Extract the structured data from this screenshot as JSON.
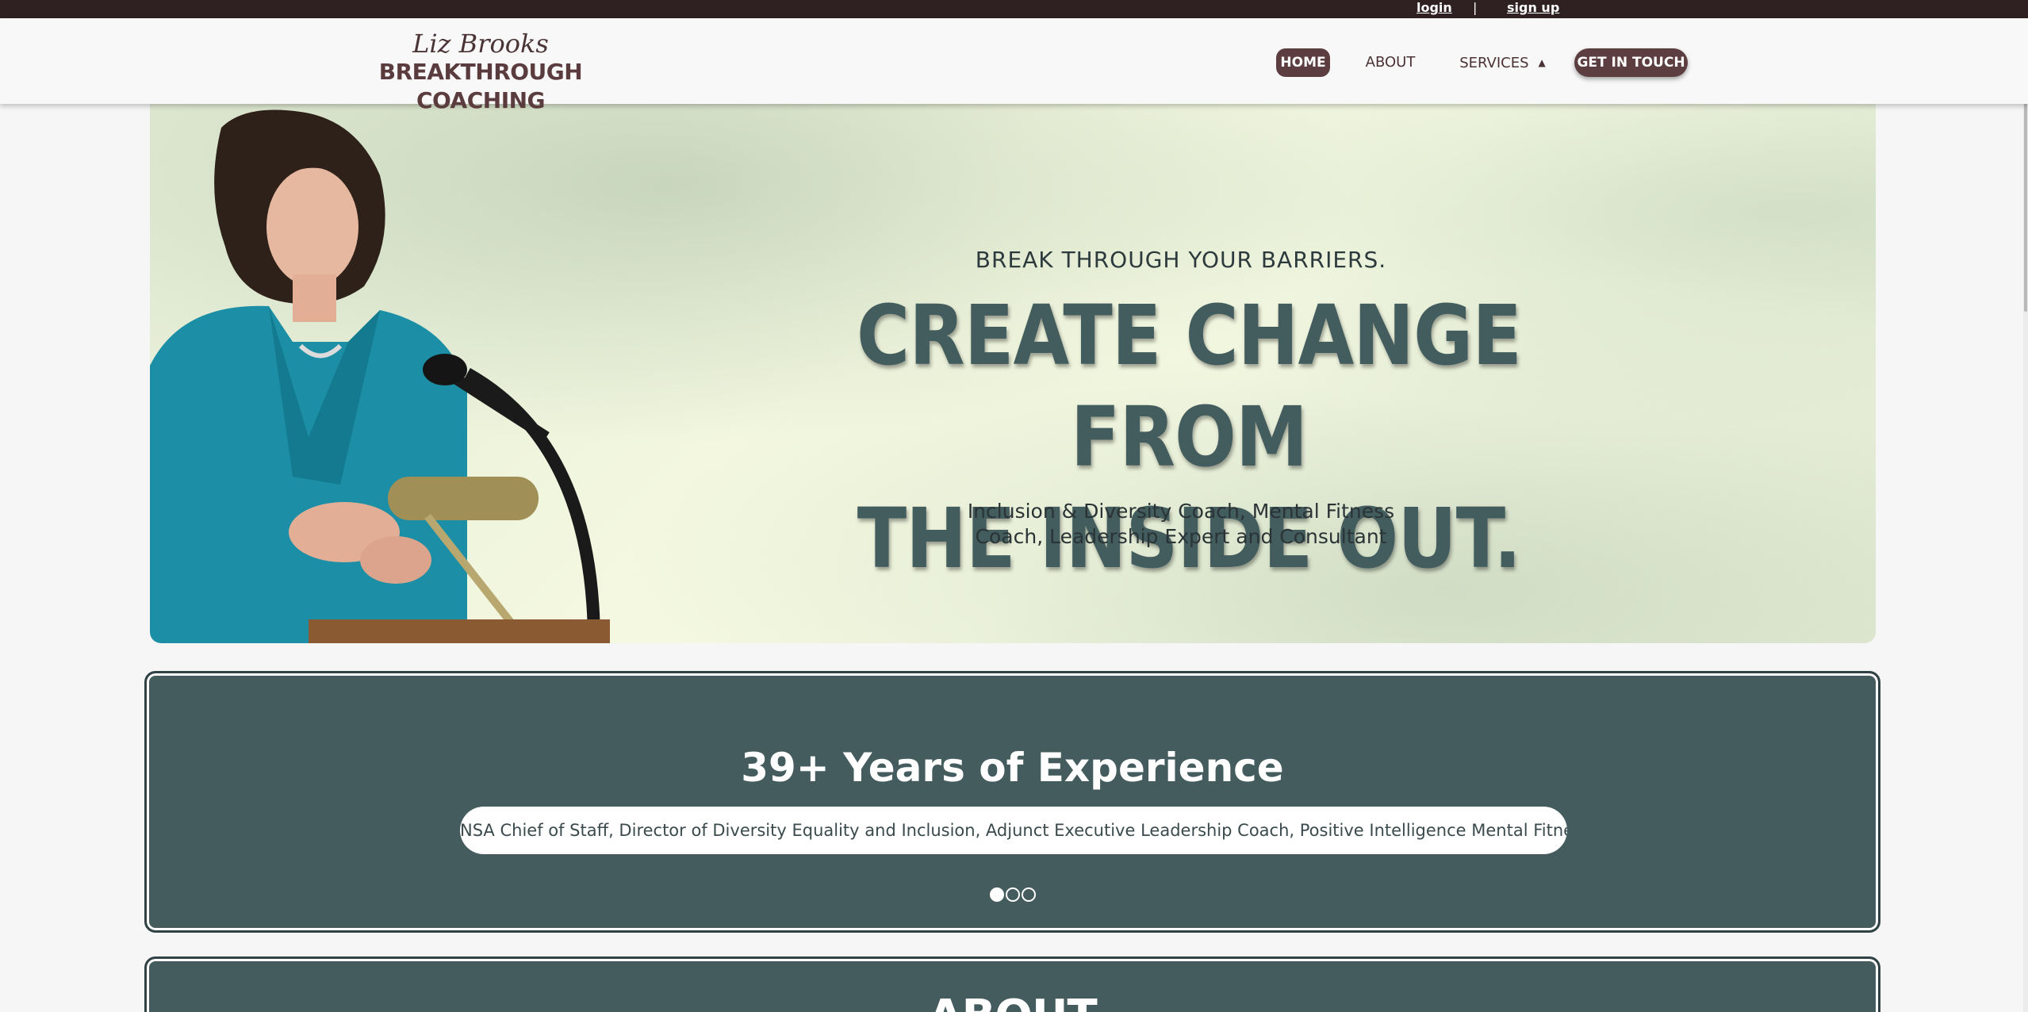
{
  "topbar": {
    "login": "login",
    "separator": "|",
    "signup": "sign up"
  },
  "brand": {
    "script": "Liz Brooks",
    "main": "BREAKTHROUGH COACHING"
  },
  "nav": {
    "home": "HOME",
    "about": "ABOUT",
    "services": "SERVICES",
    "services_caret": "▲",
    "cta": "GET IN TOUCH"
  },
  "hero": {
    "tagline": "BREAK THROUGH YOUR BARRIERS.",
    "headline_line1": "CREATE CHANGE FROM",
    "headline_line2": "THE INSIDE OUT.",
    "subtitle_line1": "Inclusion & Diversity Coach, Mental Fitness",
    "subtitle_line2": "Coach, Leadership Expert and Consultant"
  },
  "experience": {
    "title": "39+ Years of Experience",
    "roles": "NSA Chief of Staff, Director of Diversity Equality and Inclusion, Adjunct Executive Leadership Coach, Positive Intelligence Mental Fitness Coach",
    "slides_total": 3,
    "active_slide": 1
  },
  "about_section": {
    "title": "ABOUT"
  },
  "colors": {
    "topbar": "#2f2022",
    "brand_brown": "#5c3e40",
    "panel_teal": "#455c5f",
    "headline": "#435c5e"
  }
}
